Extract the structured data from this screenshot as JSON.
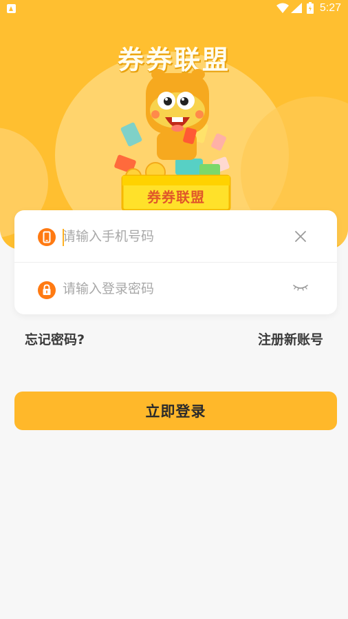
{
  "status_bar": {
    "time": "5:27",
    "icons": [
      "notification-icon",
      "wifi-icon",
      "signal-icon",
      "battery-icon"
    ]
  },
  "hero": {
    "brand_title": "券券联盟",
    "box_label": "券券联盟",
    "background_color": "#ffbf30",
    "illustration": "hamburger-mascot-with-coupons"
  },
  "form": {
    "phone": {
      "placeholder": "请输入手机号码",
      "value": "",
      "icon": "phone-icon",
      "action_icon": "clear-icon"
    },
    "password": {
      "placeholder": "请输入登录密码",
      "value": "",
      "icon": "lock-icon",
      "action_icon": "eye-closed-icon"
    }
  },
  "links": {
    "forgot_password": "忘记密码?",
    "register": "注册新账号"
  },
  "login_button": {
    "label": "立即登录",
    "color": "#ffb82a"
  },
  "colors": {
    "accent": "#ffbf30",
    "icon_orange": "#ff7a12",
    "background": "#f7f7f7"
  }
}
